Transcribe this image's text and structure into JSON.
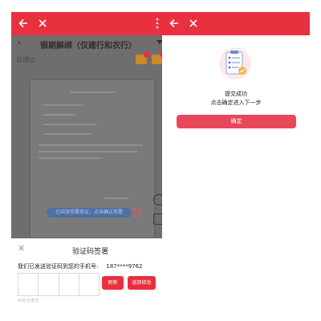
{
  "left": {
    "page_title": "银期解绑（仅建行和农行）",
    "placeholder": "云通证",
    "blue_banner": "已阅读签署协议，点击确认签署",
    "sheet": {
      "title": "验证码签署",
      "close_glyph": "✕",
      "message": "我们已发送验证码到您的手机号:",
      "phone": "187****9762",
      "resend_label": "刷新",
      "back_label": "返回修改",
      "hint": "60秒后重发"
    }
  },
  "right": {
    "success_text": "提交成功",
    "next_text": "点击确定进入下一步",
    "confirm_label": "确定"
  },
  "colors": {
    "topbar": "#e8303f",
    "confirm": "#e8475a",
    "overlay": "#6e6e6e"
  },
  "icons": [
    "back-arrow-icon",
    "close-icon",
    "more-vertical-icon",
    "clipboard-check-icon"
  ]
}
